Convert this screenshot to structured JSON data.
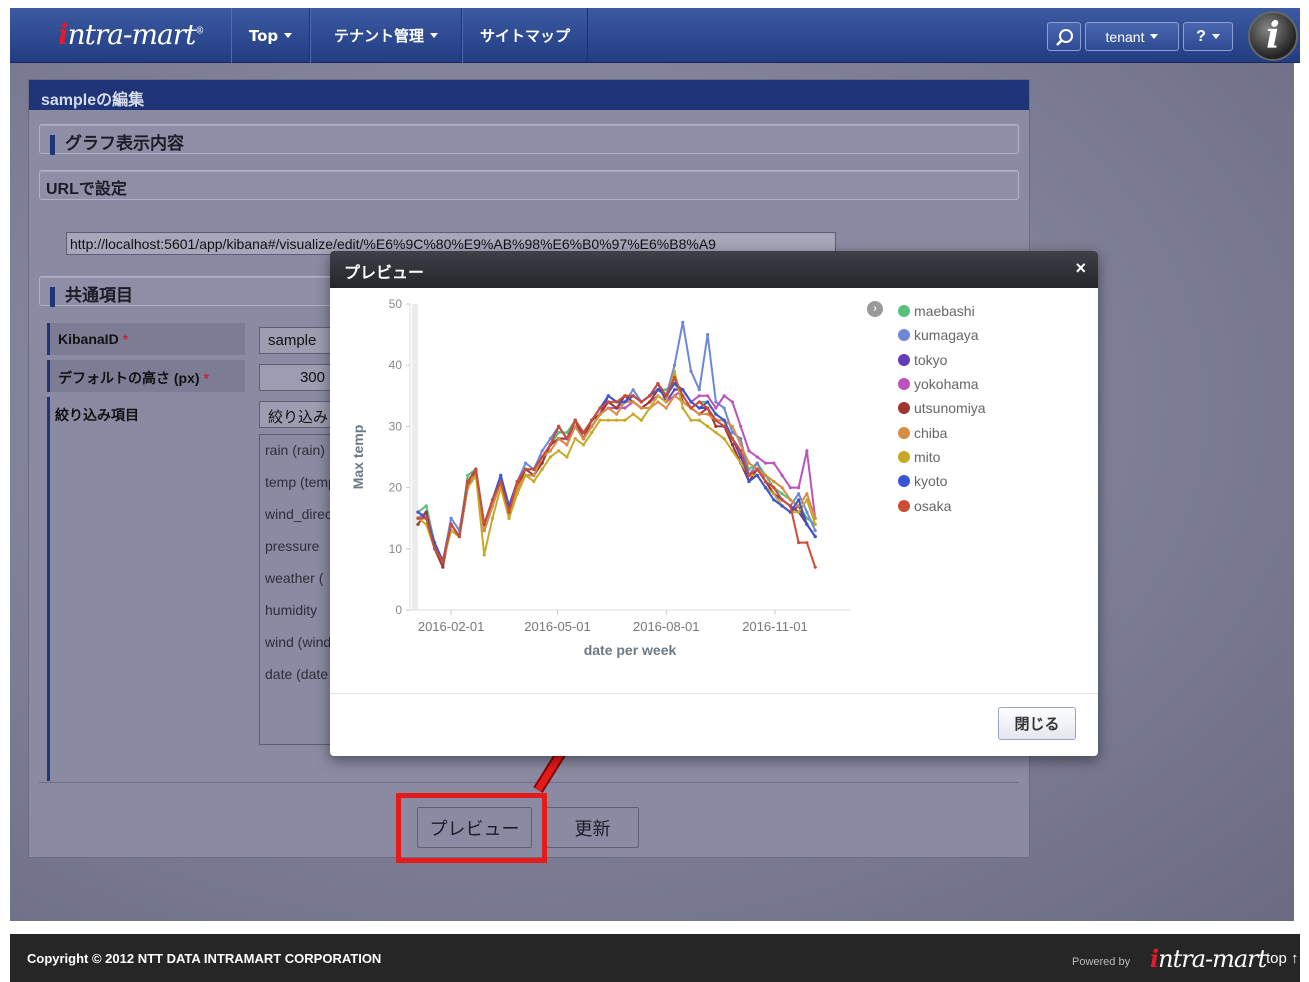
{
  "nav": {
    "logo_i": "i",
    "logo_rest": "ntra-mart",
    "logo_mark": "®",
    "items": [
      "Top",
      "テナント管理",
      "サイトマップ"
    ],
    "tenant": "tenant",
    "help": "?",
    "avatar": "i"
  },
  "panel": {
    "title": "sampleの編集",
    "section_graph": "グラフ表示内容",
    "section_url": "URLで設定",
    "url_value": "http://localhost:5601/app/kibana#/visualize/edit/%E6%9C%80%E9%AB%98%E6%B0%97%E6%B8%A9",
    "section_common": "共通項目",
    "kibana_label": "KibanaID",
    "required": "*",
    "kibana_value": "sample",
    "height_label": "デフォルトの高さ (px)",
    "height_value": "300",
    "filter_label": "絞り込み項目",
    "filter_select": "絞り込み",
    "filter_items": [
      "rain (rain)",
      "temp (temp)",
      "wind_direction",
      "pressure",
      "weather (",
      "humidity",
      "wind (wind",
      "date (date"
    ],
    "preview_button": "プレビュー",
    "update_button": "更新"
  },
  "modal": {
    "title": "プレビュー",
    "close_x": "×",
    "close_button": "閉じる"
  },
  "footer": {
    "copyright": "Copyright © 2012 NTT DATA INTRAMART CORPORATION",
    "powered": "Powered by",
    "logo_i": "i",
    "logo_rest": "ntra-mart",
    "top": "top ↑"
  },
  "chart_data": {
    "type": "line",
    "xlabel": "date per week",
    "ylabel": "Max temp",
    "ylim": [
      0,
      50
    ],
    "yticks": [
      0,
      10,
      20,
      30,
      40,
      50
    ],
    "xtick_labels": [
      "2016-02-01",
      "2016-05-01",
      "2016-08-01",
      "2016-11-01"
    ],
    "x_start": "2016-01-04",
    "x_end": "2016-12-26",
    "legend_position": "right",
    "series": [
      {
        "name": "maebashi",
        "color": "#57c17b",
        "values": [
          16,
          17,
          11,
          8,
          14,
          12,
          22,
          23,
          13,
          17,
          21,
          16,
          20,
          22,
          22,
          24,
          27,
          29,
          29,
          31,
          28,
          30,
          32,
          33,
          33,
          35,
          35,
          34,
          35,
          36,
          36,
          37,
          35,
          33,
          34,
          34,
          32,
          31,
          28,
          26,
          23,
          24,
          22,
          20,
          19,
          18,
          17,
          15,
          14
        ]
      },
      {
        "name": "kumagaya",
        "color": "#6f87d8",
        "values": [
          15,
          16,
          11,
          8,
          15,
          13,
          21,
          23,
          14,
          18,
          22,
          17,
          21,
          24,
          23,
          26,
          28,
          30,
          28,
          31,
          29,
          31,
          33,
          34,
          33,
          34,
          36,
          34,
          35,
          37,
          35,
          40,
          47,
          39,
          36,
          45,
          34,
          33,
          29,
          28,
          22,
          24,
          21,
          19,
          18,
          17,
          19,
          16,
          13
        ]
      },
      {
        "name": "tokyo",
        "color": "#663db8",
        "values": [
          15,
          15,
          10,
          8,
          13,
          12,
          20,
          22,
          14,
          17,
          21,
          16,
          20,
          22,
          22,
          25,
          27,
          28,
          28,
          30,
          28,
          30,
          32,
          35,
          34,
          34,
          35,
          34,
          35,
          37,
          34,
          36,
          36,
          34,
          33,
          33,
          31,
          30,
          28,
          25,
          22,
          22,
          20,
          19,
          18,
          17,
          16,
          14,
          12
        ]
      },
      {
        "name": "yokohama",
        "color": "#bc52bc",
        "values": [
          16,
          15,
          11,
          8,
          13,
          12,
          20,
          22,
          13,
          17,
          21,
          16,
          20,
          22,
          22,
          25,
          27,
          28,
          27,
          30,
          28,
          30,
          32,
          33,
          33,
          33,
          34,
          33,
          34,
          35,
          34,
          35,
          36,
          34,
          35,
          35,
          33,
          35,
          34,
          30,
          26,
          25,
          24,
          24,
          22,
          20,
          20,
          26,
          15
        ]
      },
      {
        "name": "utsunomiya",
        "color": "#9e3533",
        "values": [
          14,
          16,
          10,
          7,
          14,
          12,
          20,
          23,
          13,
          17,
          21,
          15,
          20,
          23,
          22,
          24,
          27,
          28,
          28,
          31,
          28,
          31,
          32,
          34,
          33,
          35,
          34,
          33,
          34,
          36,
          35,
          38,
          34,
          33,
          32,
          33,
          30,
          30,
          27,
          24,
          21,
          23,
          21,
          19,
          17,
          16,
          17,
          14,
          12
        ]
      },
      {
        "name": "chiba",
        "color": "#da8b45",
        "values": [
          15,
          15,
          10,
          8,
          13,
          12,
          21,
          22,
          13,
          17,
          21,
          16,
          20,
          22,
          22,
          25,
          26,
          28,
          27,
          30,
          28,
          30,
          32,
          33,
          32,
          34,
          34,
          33,
          33,
          34,
          33,
          35,
          34,
          33,
          32,
          32,
          31,
          31,
          30,
          27,
          24,
          23,
          22,
          21,
          20,
          18,
          17,
          19,
          15
        ]
      },
      {
        "name": "mito",
        "color": "#c7a927",
        "values": [
          15,
          14,
          10,
          8,
          13,
          12,
          20,
          22,
          9,
          15,
          20,
          15,
          19,
          22,
          21,
          23,
          25,
          26,
          25,
          28,
          27,
          29,
          31,
          31,
          31,
          31,
          32,
          31,
          33,
          35,
          34,
          39,
          33,
          31,
          31,
          30,
          29,
          28,
          26,
          24,
          22,
          22,
          20,
          19,
          17,
          16,
          16,
          18,
          14
        ]
      },
      {
        "name": "kyoto",
        "color": "#3a56d0",
        "values": [
          16,
          15,
          11,
          8,
          14,
          12,
          21,
          23,
          14,
          18,
          22,
          17,
          21,
          23,
          23,
          25,
          27,
          30,
          28,
          31,
          29,
          31,
          33,
          35,
          34,
          34,
          35,
          34,
          35,
          36,
          35,
          37,
          36,
          34,
          33,
          34,
          32,
          31,
          28,
          26,
          21,
          22,
          20,
          18,
          17,
          16,
          18,
          14,
          12
        ]
      },
      {
        "name": "osaka",
        "color": "#cc4c35",
        "values": [
          15,
          15,
          10,
          8,
          14,
          12,
          21,
          23,
          14,
          18,
          21,
          16,
          21,
          23,
          23,
          25,
          27,
          30,
          28,
          31,
          29,
          31,
          33,
          34,
          34,
          35,
          35,
          34,
          35,
          37,
          35,
          38,
          35,
          33,
          34,
          33,
          31,
          30,
          28,
          26,
          22,
          23,
          21,
          20,
          18,
          17,
          11,
          11,
          7
        ]
      }
    ]
  }
}
